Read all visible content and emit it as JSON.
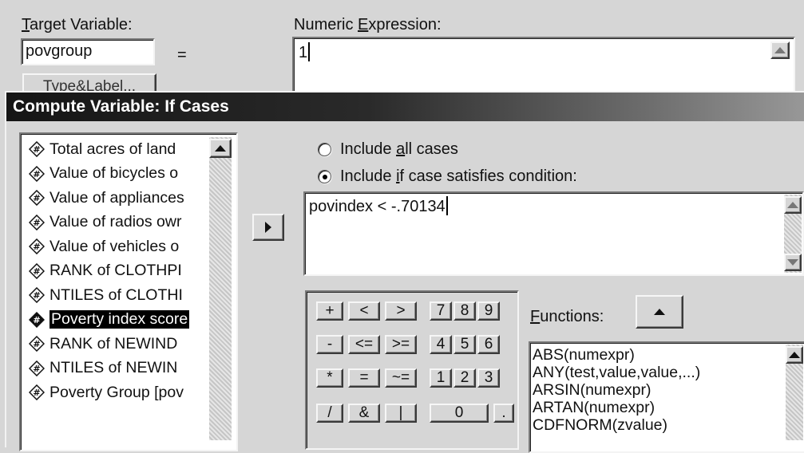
{
  "top": {
    "target_label_first": "T",
    "target_label_rest": "arget Variable:",
    "target_value": "povgroup",
    "equals": "=",
    "type_label_button": "Type&Label...",
    "numexpr_label_pre": "Numeric ",
    "numexpr_label_u": "E",
    "numexpr_label_post": "xpression:",
    "numexpr_value": "1"
  },
  "dialog": {
    "title": "Compute Variable: If Cases"
  },
  "variables": [
    {
      "label": "Total acres of land"
    },
    {
      "label": "Value of bicycles o"
    },
    {
      "label": "Value of appliances"
    },
    {
      "label": "Value of radios owr"
    },
    {
      "label": "Value of vehicles o"
    },
    {
      "label": "RANK of CLOTHPI"
    },
    {
      "label": "NTILES of CLOTHI"
    },
    {
      "label": "Poverty index score",
      "selected": true
    },
    {
      "label": "RANK of NEWIND"
    },
    {
      "label": "NTILES of NEWIN"
    },
    {
      "label": "Poverty Group [pov"
    }
  ],
  "radios": {
    "all_pre": "Include ",
    "all_u": "a",
    "all_post": "ll cases",
    "if_pre": "Include ",
    "if_u": "i",
    "if_post": "f case satisfies condition:",
    "selected": "if"
  },
  "condition": {
    "value": "povindex < -.70134"
  },
  "keypad": {
    "keys": [
      "+",
      "<",
      ">",
      "7",
      "8",
      "9",
      "-",
      "<=",
      ">=",
      "4",
      "5",
      "6",
      "*",
      "=",
      "~=",
      "1",
      "2",
      "3",
      "/",
      "&",
      "|",
      "0",
      "."
    ]
  },
  "functions": {
    "label_u": "F",
    "label_rest": "unctions:",
    "items": [
      "ABS(numexpr)",
      "ANY(test,value,value,...)",
      "ARSIN(numexpr)",
      "ARTAN(numexpr)",
      "CDFNORM(zvalue)"
    ]
  },
  "icons": {
    "variable": "numeric-variable-icon",
    "move": "right-arrow-icon",
    "scroll_up": "scroll-up-icon"
  },
  "colors": {
    "titlebar_left": "#1a1a1a",
    "titlebar_right": "#8a8a8a",
    "face": "#d6d6d6",
    "selection": "#000000"
  }
}
